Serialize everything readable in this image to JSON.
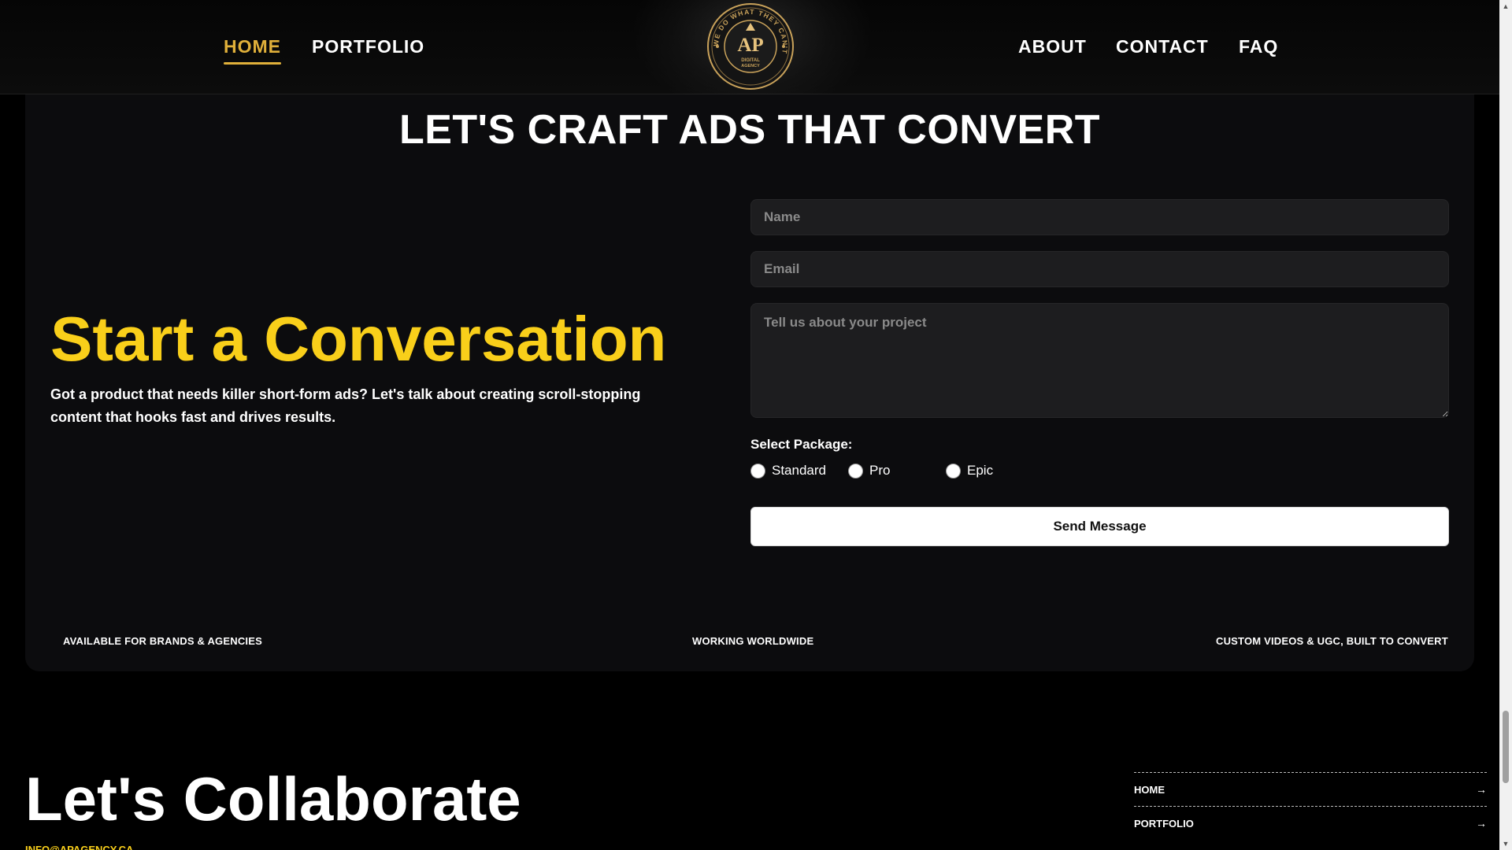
{
  "nav": {
    "left": [
      {
        "label": "HOME",
        "active": true
      },
      {
        "label": "PORTFOLIO",
        "active": false
      }
    ],
    "right": [
      {
        "label": "ABOUT"
      },
      {
        "label": "CONTACT"
      },
      {
        "label": "FAQ"
      }
    ],
    "logo": {
      "ring_text": "WE DO WHAT THEY CAN'T",
      "initials": "AP",
      "sub_line1": "DIGITAL",
      "sub_line2": "AGENCY",
      "color": "#c9a25a"
    }
  },
  "contact": {
    "section_title": "LET'S CRAFT ADS THAT CONVERT",
    "heading": "Start a Conversation",
    "intro": "Got a product that needs killer short-form ads? Let's talk about creating scroll-stopping content that hooks fast and drives results.",
    "form": {
      "name_placeholder": "Name",
      "email_placeholder": "Email",
      "message_placeholder": "Tell us about your project",
      "package_label": "Select Package:",
      "packages": [
        "Standard",
        "Pro",
        "Epic"
      ],
      "submit_label": "Send Message"
    },
    "tags": [
      "AVAILABLE FOR BRANDS & AGENCIES",
      "WORKING WORLDWIDE",
      "CUSTOM VIDEOS & UGC, BUILT TO CONVERT"
    ]
  },
  "footer": {
    "heading": "Let's Collaborate",
    "email": "INFO@APAGENCY.CA",
    "nav": [
      {
        "label": "HOME",
        "arrow": "→"
      },
      {
        "label": "PORTFOLIO",
        "arrow": "→"
      }
    ]
  },
  "scrollbar": {
    "up_arrow": "▲",
    "down_arrow": "▼",
    "position_fraction": 0.93
  },
  "colors": {
    "accent_gold": "#e0b03a",
    "heading_yellow": "#f9cf1a",
    "card_bg": "#0c0c0e",
    "input_bg": "#1d1d1f"
  }
}
